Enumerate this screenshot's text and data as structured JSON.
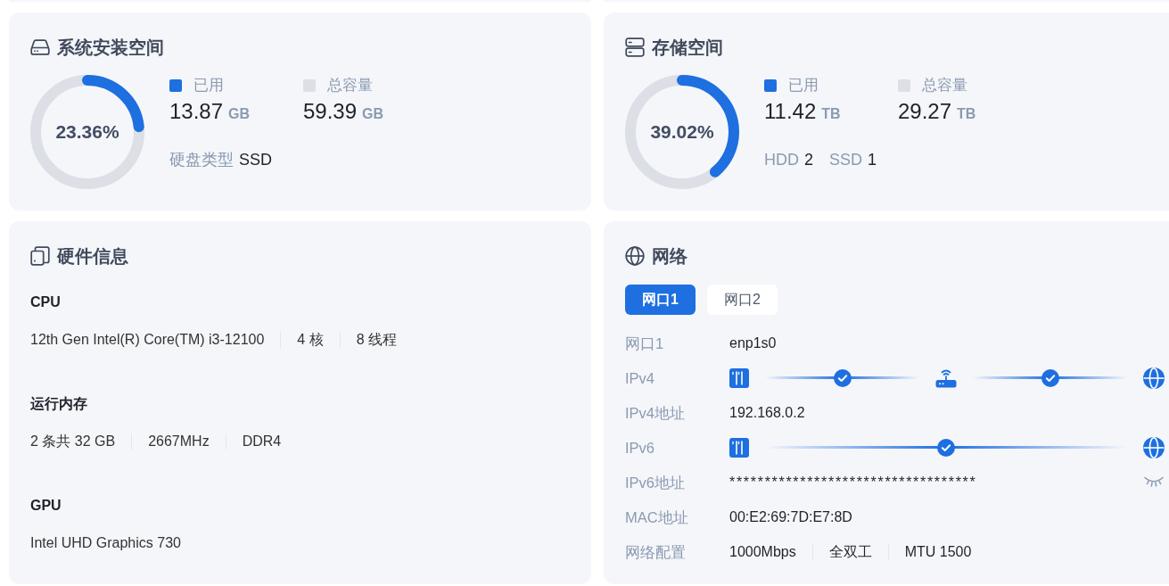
{
  "storage_cards": [
    {
      "kind": "system",
      "title": "系统安装空间",
      "percent": "23.36%",
      "level": 0.2336,
      "legend": [
        {
          "label": "已用",
          "color": "#1e6fe0",
          "value": "13.87",
          "unit": "GB"
        },
        {
          "label": "总容量",
          "color": "#dcdfe6",
          "value": "59.39",
          "unit": "GB"
        }
      ],
      "details": [
        {
          "label": "硬盘类型",
          "value": "SSD"
        }
      ]
    },
    {
      "kind": "storage",
      "title": "存储空间",
      "percent": "39.02%",
      "level": 0.3902,
      "legend": [
        {
          "label": "已用",
          "color": "#1e6fe0",
          "value": "11.42",
          "unit": "TB"
        },
        {
          "label": "总容量",
          "color": "#dcdfe6",
          "value": "29.27",
          "unit": "TB"
        }
      ],
      "details": [
        {
          "label": "HDD",
          "value": "2"
        },
        {
          "label": "SSD",
          "value": "1"
        }
      ]
    }
  ],
  "hardware": {
    "title": "硬件信息",
    "sections": [
      {
        "heading": "CPU",
        "values": [
          "12th Gen Intel(R) Core(TM) i3-12100",
          "4 核",
          "8 线程"
        ]
      },
      {
        "heading": "运行内存",
        "values": [
          "2 条共 32 GB",
          "2667MHz",
          "DDR4"
        ]
      },
      {
        "heading": "GPU",
        "values": [
          "Intel UHD Graphics 730"
        ]
      }
    ]
  },
  "network": {
    "title": "网络",
    "tabs": [
      {
        "label": "网口1",
        "selected": true
      },
      {
        "label": "网口2",
        "selected": false
      }
    ],
    "rows": [
      {
        "kind": "text",
        "label": "网口1",
        "values": [
          "enp1s0"
        ]
      },
      {
        "kind": "path",
        "label": "IPv4",
        "nodes": [
          {
            "kind": "server"
          },
          {
            "kind": "router"
          },
          {
            "kind": "internet"
          }
        ],
        "links": [
          {
            "connected": true
          },
          {
            "connected": true
          }
        ]
      },
      {
        "kind": "text",
        "label": "IPv4地址",
        "values": [
          "192.168.0.2"
        ]
      },
      {
        "kind": "path",
        "label": "IPv6",
        "nodes": [
          {
            "kind": "server"
          },
          {
            "kind": "internet"
          }
        ],
        "links": [
          {
            "connected": true
          }
        ]
      },
      {
        "kind": "secret",
        "label": "IPv6地址",
        "value": "***********************************",
        "masked": true
      },
      {
        "kind": "text",
        "label": "MAC地址",
        "values": [
          "00:E2:69:7D:E7:8D"
        ]
      },
      {
        "kind": "text",
        "label": "网络配置",
        "values": [
          "1000Mbps",
          "全双工",
          "MTU 1500"
        ]
      }
    ]
  }
}
